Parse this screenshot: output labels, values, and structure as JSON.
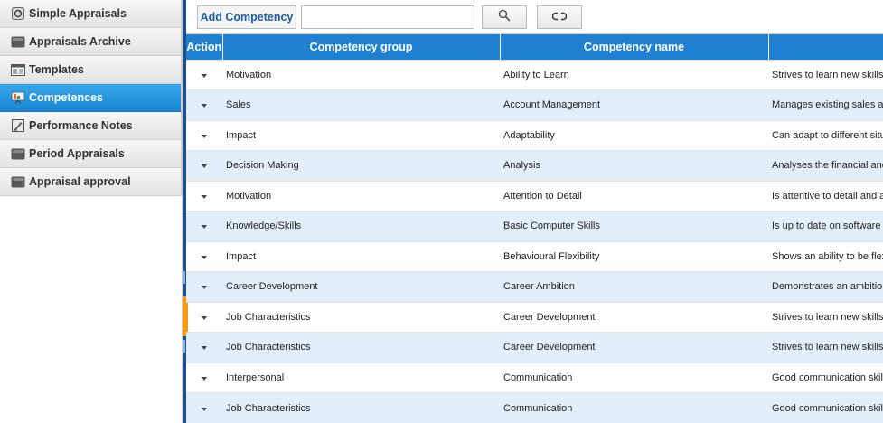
{
  "sidebar": {
    "items": [
      {
        "label": "Simple Appraisals",
        "icon": "refresh-doc-icon",
        "active": false
      },
      {
        "label": "Appraisals Archive",
        "icon": "folder-icon",
        "active": false
      },
      {
        "label": "Templates",
        "icon": "template-icon",
        "active": false
      },
      {
        "label": "Competences",
        "icon": "presentation-icon",
        "active": true
      },
      {
        "label": "Performance Notes",
        "icon": "note-icon",
        "active": false
      },
      {
        "label": "Period Appraisals",
        "icon": "folder-icon",
        "active": false
      },
      {
        "label": "Appraisal approval",
        "icon": "folder-icon",
        "active": false
      }
    ]
  },
  "toolbar": {
    "add_label": "Add Competency",
    "search_placeholder": "",
    "search_value": "",
    "search_icon": "magnifier-icon",
    "reset_icon": "link-reset-icon"
  },
  "table": {
    "columns": [
      "Action",
      "Competency group",
      "Competency name",
      ""
    ],
    "rows": [
      {
        "group": "Motivation",
        "name": "Ability to Learn",
        "desc": "Strives to learn new skills"
      },
      {
        "group": "Sales",
        "name": "Account Management",
        "desc": "Manages existing sales ac"
      },
      {
        "group": "Impact",
        "name": "Adaptability",
        "desc": "Can adapt to different situ"
      },
      {
        "group": "Decision Making",
        "name": "Analysis",
        "desc": "Analyses the financial and"
      },
      {
        "group": "Motivation",
        "name": "Attention to Detail",
        "desc": "Is attentive to detail and ac"
      },
      {
        "group": "Knowledge/Skills",
        "name": "Basic Computer Skills",
        "desc": "Is up to date on software p"
      },
      {
        "group": "Impact",
        "name": "Behavioural Flexibility",
        "desc": "Shows an ability to be flex"
      },
      {
        "group": "Career Development",
        "name": "Career Ambition",
        "desc": "Demonstrates an ambition"
      },
      {
        "group": "Job Characteristics",
        "name": "Career Development",
        "desc": "Strives to learn new skills"
      },
      {
        "group": "Job Characteristics",
        "name": "Career Development",
        "desc": "Strives to learn new skills"
      },
      {
        "group": "Interpersonal",
        "name": "Communication",
        "desc": "Good communication skills"
      },
      {
        "group": "Job Characteristics",
        "name": "Communication",
        "desc": "Good communication skills"
      }
    ]
  },
  "colors": {
    "accent": "#1f7fd0",
    "active_nav": "#1a86d4",
    "row_alt": "#e3eefb",
    "splitter_handle": "#f39a1a"
  }
}
